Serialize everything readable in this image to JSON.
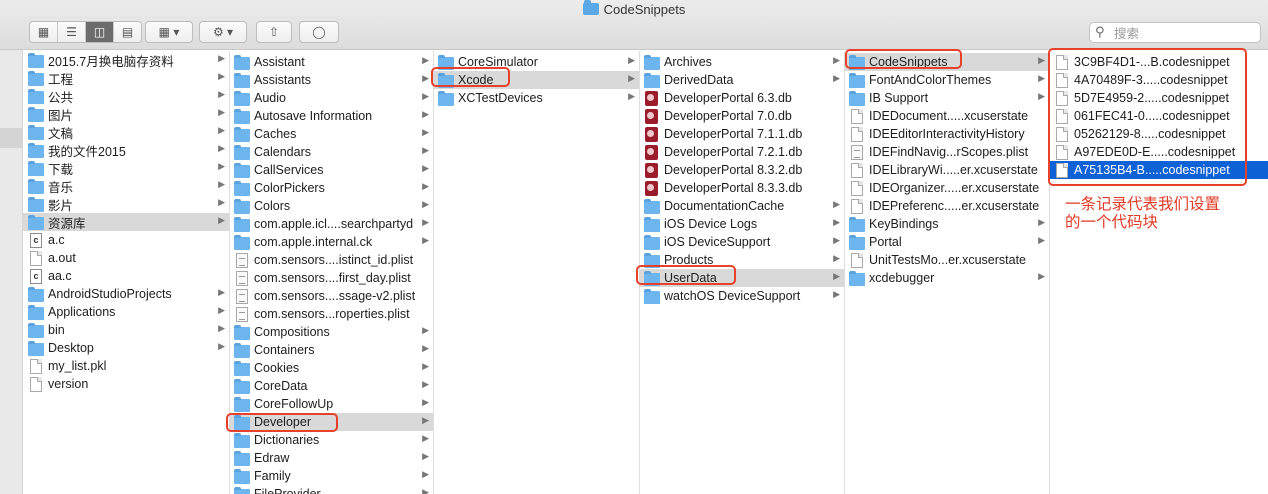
{
  "window": {
    "title": "CodeSnippets"
  },
  "toolbar": {
    "view_icons": [
      "icon-view-icon",
      "list-view-icon",
      "column-view-icon",
      "gallery-view-icon"
    ],
    "search_placeholder": "搜索"
  },
  "col1": [
    {
      "label": "2015.7月换电脑存资料",
      "icon": "folder",
      "arrow": true
    },
    {
      "label": "工程",
      "icon": "folder",
      "arrow": true
    },
    {
      "label": "公共",
      "icon": "folder",
      "arrow": true
    },
    {
      "label": "图片",
      "icon": "folder",
      "arrow": true
    },
    {
      "label": "文稿",
      "icon": "folder",
      "arrow": true
    },
    {
      "label": "我的文件2015",
      "icon": "folder",
      "arrow": true
    },
    {
      "label": "下载",
      "icon": "folder",
      "arrow": true
    },
    {
      "label": "音乐",
      "icon": "folder",
      "arrow": true
    },
    {
      "label": "影片",
      "icon": "folder",
      "arrow": true
    },
    {
      "label": "资源库",
      "icon": "folder",
      "arrow": true,
      "sel": "gray"
    },
    {
      "label": "a.c",
      "icon": "code",
      "arrow": false
    },
    {
      "label": "a.out",
      "icon": "file",
      "arrow": false
    },
    {
      "label": "aa.c",
      "icon": "code",
      "arrow": false
    },
    {
      "label": "AndroidStudioProjects",
      "icon": "folder",
      "arrow": true
    },
    {
      "label": "Applications",
      "icon": "folder",
      "arrow": true
    },
    {
      "label": "bin",
      "icon": "folder",
      "arrow": true
    },
    {
      "label": "Desktop",
      "icon": "folder",
      "arrow": true
    },
    {
      "label": "my_list.pkl",
      "icon": "file",
      "arrow": false
    },
    {
      "label": "version",
      "icon": "file",
      "arrow": false
    }
  ],
  "col2": [
    {
      "label": "Assistant",
      "icon": "folder",
      "arrow": true
    },
    {
      "label": "Assistants",
      "icon": "folder",
      "arrow": true
    },
    {
      "label": "Audio",
      "icon": "folder",
      "arrow": true
    },
    {
      "label": "Autosave Information",
      "icon": "folder",
      "arrow": true
    },
    {
      "label": "Caches",
      "icon": "folder",
      "arrow": true
    },
    {
      "label": "Calendars",
      "icon": "folder",
      "arrow": true
    },
    {
      "label": "CallServices",
      "icon": "folder",
      "arrow": true
    },
    {
      "label": "ColorPickers",
      "icon": "folder",
      "arrow": true
    },
    {
      "label": "Colors",
      "icon": "folder",
      "arrow": true
    },
    {
      "label": "com.apple.icl....searchpartyd",
      "icon": "folder",
      "arrow": true
    },
    {
      "label": "com.apple.internal.ck",
      "icon": "folder",
      "arrow": true
    },
    {
      "label": "com.sensors....istinct_id.plist",
      "icon": "plist",
      "arrow": false
    },
    {
      "label": "com.sensors....first_day.plist",
      "icon": "plist",
      "arrow": false
    },
    {
      "label": "com.sensors....ssage-v2.plist",
      "icon": "plist",
      "arrow": false
    },
    {
      "label": "com.sensors...roperties.plist",
      "icon": "plist",
      "arrow": false
    },
    {
      "label": "Compositions",
      "icon": "folder",
      "arrow": true
    },
    {
      "label": "Containers",
      "icon": "folder",
      "arrow": true
    },
    {
      "label": "Cookies",
      "icon": "folder",
      "arrow": true
    },
    {
      "label": "CoreData",
      "icon": "folder",
      "arrow": true
    },
    {
      "label": "CoreFollowUp",
      "icon": "folder",
      "arrow": true
    },
    {
      "label": "Developer",
      "icon": "folder",
      "arrow": true,
      "sel": "gray"
    },
    {
      "label": "Dictionaries",
      "icon": "folder",
      "arrow": true
    },
    {
      "label": "Edraw",
      "icon": "folder",
      "arrow": true
    },
    {
      "label": "Family",
      "icon": "folder",
      "arrow": true
    },
    {
      "label": "FileProvider",
      "icon": "folder",
      "arrow": true
    }
  ],
  "col3": [
    {
      "label": "CoreSimulator",
      "icon": "folder",
      "arrow": true
    },
    {
      "label": "Xcode",
      "icon": "folder",
      "arrow": true,
      "sel": "gray"
    },
    {
      "label": "XCTestDevices",
      "icon": "folder",
      "arrow": true
    }
  ],
  "col4": [
    {
      "label": "Archives",
      "icon": "folder",
      "arrow": true
    },
    {
      "label": "DerivedData",
      "icon": "folder",
      "arrow": true
    },
    {
      "label": "DeveloperPortal 6.3.db",
      "icon": "db",
      "arrow": false
    },
    {
      "label": "DeveloperPortal 7.0.db",
      "icon": "db",
      "arrow": false
    },
    {
      "label": "DeveloperPortal 7.1.1.db",
      "icon": "db",
      "arrow": false
    },
    {
      "label": "DeveloperPortal 7.2.1.db",
      "icon": "db",
      "arrow": false
    },
    {
      "label": "DeveloperPortal 8.3.2.db",
      "icon": "db",
      "arrow": false
    },
    {
      "label": "DeveloperPortal 8.3.3.db",
      "icon": "db",
      "arrow": false
    },
    {
      "label": "DocumentationCache",
      "icon": "folder",
      "arrow": true
    },
    {
      "label": "iOS Device Logs",
      "icon": "folder",
      "arrow": true
    },
    {
      "label": "iOS DeviceSupport",
      "icon": "folder",
      "arrow": true
    },
    {
      "label": "Products",
      "icon": "folder",
      "arrow": true
    },
    {
      "label": "UserData",
      "icon": "folder",
      "arrow": true,
      "sel": "gray"
    },
    {
      "label": "watchOS DeviceSupport",
      "icon": "folder",
      "arrow": true
    }
  ],
  "col5": [
    {
      "label": "CodeSnippets",
      "icon": "folder",
      "arrow": true,
      "sel": "gray"
    },
    {
      "label": "FontAndColorThemes",
      "icon": "folder",
      "arrow": true
    },
    {
      "label": "IB Support",
      "icon": "folder",
      "arrow": true
    },
    {
      "label": "IDEDocument.....xcuserstate",
      "icon": "file",
      "arrow": false
    },
    {
      "label": "IDEEditorInteractivityHistory",
      "icon": "file",
      "arrow": false
    },
    {
      "label": "IDEFindNavig...rScopes.plist",
      "icon": "plist",
      "arrow": false
    },
    {
      "label": "IDELibraryWi.....er.xcuserstate",
      "icon": "file",
      "arrow": false
    },
    {
      "label": "IDEOrganizer.....er.xcuserstate",
      "icon": "file",
      "arrow": false
    },
    {
      "label": "IDEPreferenc.....er.xcuserstate",
      "icon": "file",
      "arrow": false
    },
    {
      "label": "KeyBindings",
      "icon": "folder",
      "arrow": true
    },
    {
      "label": "Portal",
      "icon": "folder",
      "arrow": true
    },
    {
      "label": "UnitTestsMo...er.xcuserstate",
      "icon": "file",
      "arrow": false
    },
    {
      "label": "xcdebugger",
      "icon": "folder",
      "arrow": true
    }
  ],
  "col6": [
    {
      "label": "3C9BF4D1-...B.codesnippet",
      "icon": "file",
      "arrow": false
    },
    {
      "label": "4A70489F-3.....codesnippet",
      "icon": "file",
      "arrow": false
    },
    {
      "label": "5D7E4959-2.....codesnippet",
      "icon": "file",
      "arrow": false
    },
    {
      "label": "061FEC41-0.....codesnippet",
      "icon": "file",
      "arrow": false
    },
    {
      "label": "05262129-8.....codesnippet",
      "icon": "file",
      "arrow": false
    },
    {
      "label": "A97EDE0D-E.....codesnippet",
      "icon": "file",
      "arrow": false
    },
    {
      "label": "A75135B4-B.....codesnippet",
      "icon": "file",
      "arrow": false,
      "sel": "blue"
    }
  ],
  "annotation": {
    "line1": "一条记录代表我们设置",
    "line2": "的一个代码块",
    "color": "#e03a24"
  },
  "colors": {
    "selection_blue": "#0f62d6",
    "highlight_red": "#e8412b",
    "folder_blue": "#6cb5ee"
  }
}
